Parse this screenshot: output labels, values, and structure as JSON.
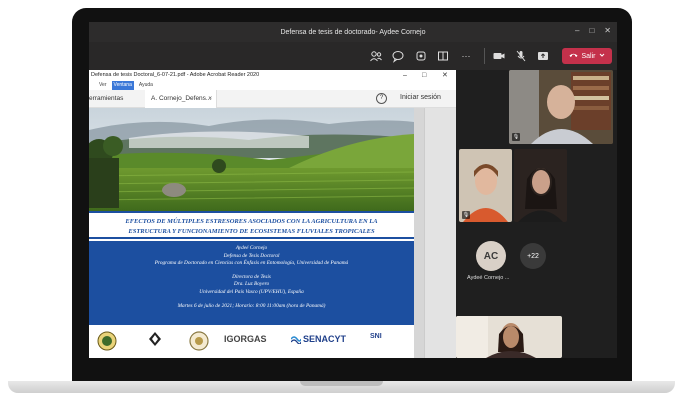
{
  "teams": {
    "meeting_title": "Defensa de tesis de doctorado- Aydee Cornejo",
    "window_controls": [
      "–",
      "□",
      "✕"
    ],
    "leave_label": "Salir",
    "more_label": "···",
    "toolbar_icons": [
      "people-icon",
      "chat-icon",
      "reactions-icon",
      "rooms-icon",
      "more-icon",
      "camera-icon",
      "mic-off-icon",
      "share-icon"
    ]
  },
  "acrobat": {
    "window_title": "Defensa de tesis Doctoral_6-07-21.pdf - Adobe Acrobat Reader 2020",
    "menu": [
      "Ver",
      "Ventana",
      "Ayuda"
    ],
    "tab_tools": "erramientas",
    "tab_doc": "A. Cornejo_Defens...",
    "tab_close": "×",
    "help": "?",
    "login": "Iniciar sesión"
  },
  "slide": {
    "title_line1": "EFECTOS DE MÚLTIPLES ESTRESORES ASOCIADOS CON LA AGRICULTURA EN LA",
    "title_line2": "ESTRUCTURA Y FUNCIONAMIENTO DE ECOSISTEMAS FLUVIALES TROPICALES",
    "author": "Aydeé Cornejo",
    "defense": "Defensa de Tesis Doctoral",
    "program": "Programa de Doctorado en Ciencias con Énfasis en Entomología, Universidad de Panamá",
    "director_label": "Directora de Tesis",
    "director": "Dra. Luz Boyero",
    "university": "Universidad del País Vasco (UPV/EHU), España",
    "date": "Martes 6 de julio de 2021; Horario: 8:00  11:00am (hora de Panamá)",
    "logos": [
      "IGORGAS",
      "SENACYT",
      "SNI"
    ]
  },
  "participants": {
    "initials": "AC",
    "name": "Aydeé Cornejo ...",
    "overflow": "+22"
  },
  "colors": {
    "slide_blue": "#1c4fa0",
    "leave_red": "#c4314b",
    "teams_dark": "#292828"
  }
}
